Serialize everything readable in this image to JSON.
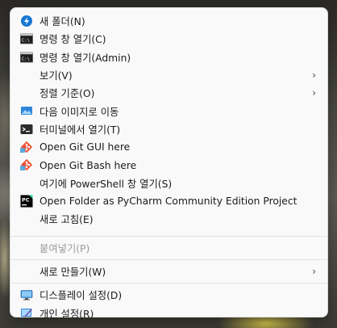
{
  "menu": {
    "items": [
      {
        "label": "새 폴더(N)",
        "icon": "new-folder-icon"
      },
      {
        "label": "명령 창 열기(C)",
        "icon": "command-prompt-icon"
      },
      {
        "label": "명령 창 열기(Admin)",
        "icon": "command-prompt-icon"
      },
      {
        "label": "보기(V)",
        "submenu": true
      },
      {
        "label": "정렬 기준(O)",
        "submenu": true
      },
      {
        "label": "다음 이미지로 이동",
        "icon": "desktop-background-icon"
      },
      {
        "label": "터미널에서 열기(T)",
        "icon": "terminal-icon"
      },
      {
        "label": "Open Git GUI here",
        "icon": "git-icon"
      },
      {
        "label": "Open Git Bash here",
        "icon": "git-icon"
      },
      {
        "label": "여기에 PowerShell 창 열기(S)"
      },
      {
        "label": "Open Folder as PyCharm Community Edition Project",
        "icon": "pycharm-icon"
      },
      {
        "label": "새로 고침(E)"
      },
      {
        "label": "붙여넣기(P)",
        "disabled": true
      },
      {
        "label": "새로 만들기(W)",
        "submenu": true
      },
      {
        "label": "디스플레이 설정(D)",
        "icon": "display-settings-icon"
      },
      {
        "label": "개인 설정(R)",
        "icon": "personalize-icon"
      }
    ]
  }
}
